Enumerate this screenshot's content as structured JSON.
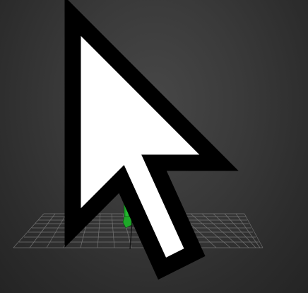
{
  "viewport": {
    "background_color": "#3a3a3a",
    "grid_color": "#8a8a8a"
  },
  "character": {
    "head_color": "#9aa6b8",
    "torso_color": "#1f8aa0",
    "pelvis_color": "#c8a43a",
    "left_limb_color": "#1fa82a",
    "right_limb_color": "#2030d8"
  },
  "cursor": {
    "icon": "mouse-pointer-icon"
  }
}
